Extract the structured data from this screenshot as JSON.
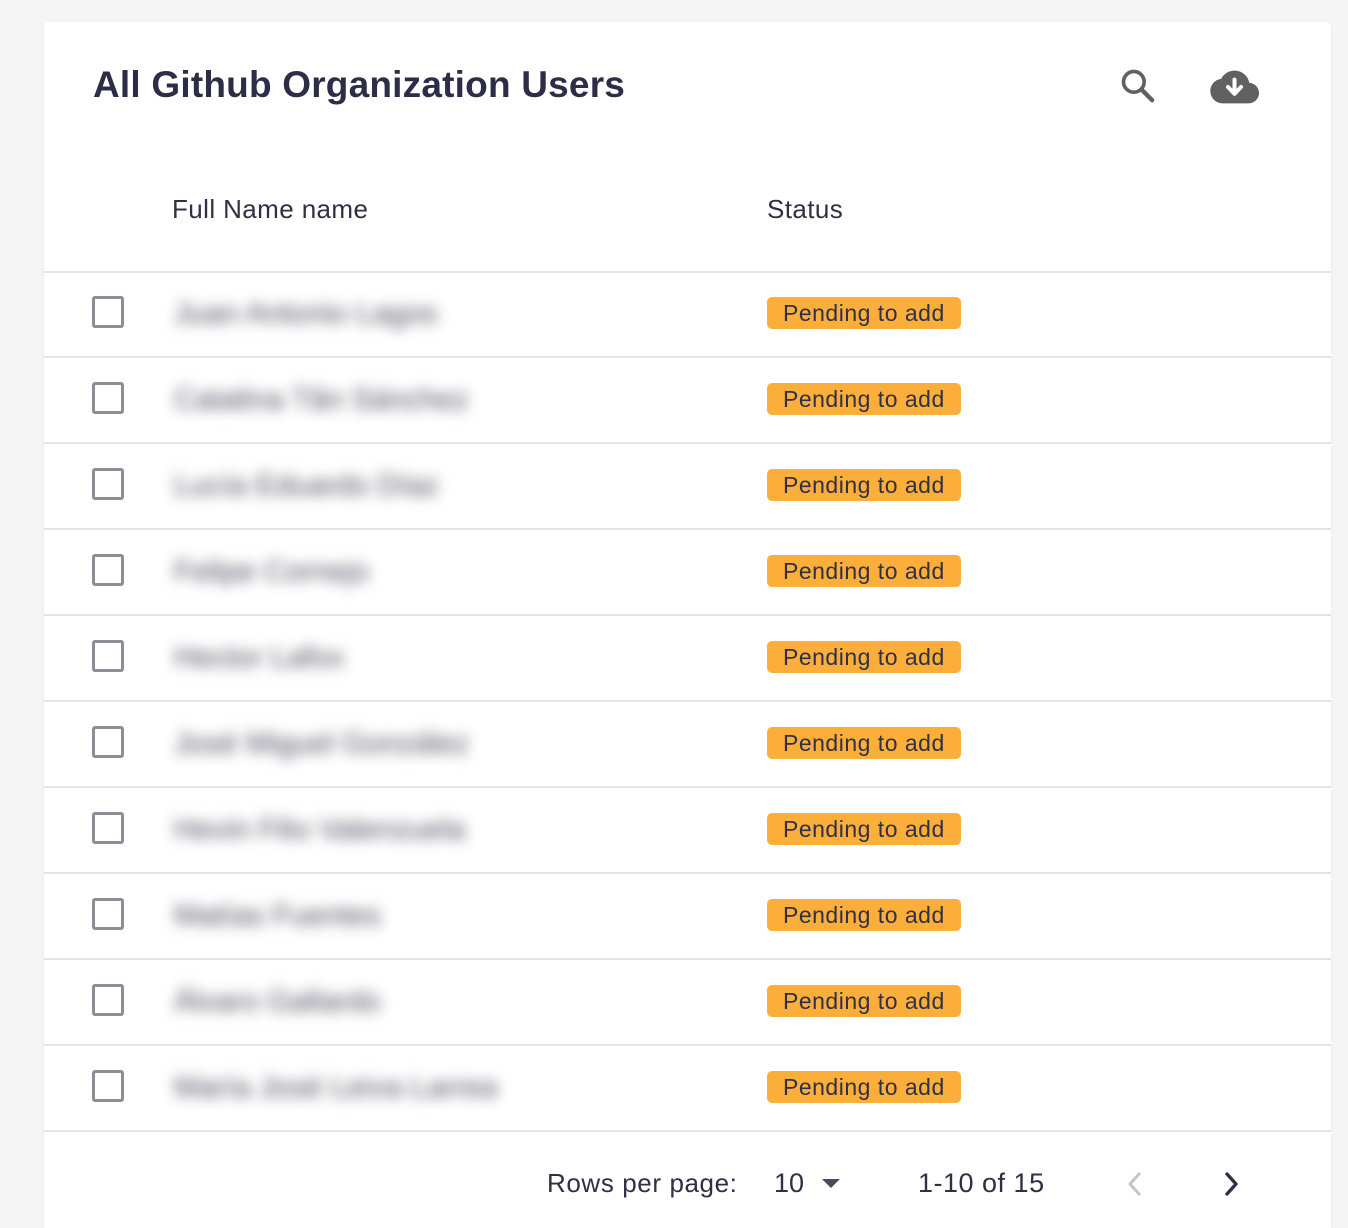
{
  "page": {
    "title": "All Github Organization Users"
  },
  "toolbar": {
    "search_icon": "search-icon",
    "download_icon": "cloud-download-icon"
  },
  "table": {
    "columns": [
      {
        "label": "Full Name name"
      },
      {
        "label": "Status"
      }
    ],
    "rows": [
      {
        "name": "Juan Antonio Lagos",
        "status": "Pending to add"
      },
      {
        "name": "Catalina Tân Sánchez",
        "status": "Pending to add"
      },
      {
        "name": "Lucía Eduardo Díaz",
        "status": "Pending to add"
      },
      {
        "name": "Felipe Cornejo",
        "status": "Pending to add"
      },
      {
        "name": "Hector Lafox",
        "status": "Pending to add"
      },
      {
        "name": "José Miguel González",
        "status": "Pending to add"
      },
      {
        "name": "Hevin Fêo Valenzuela",
        "status": "Pending to add"
      },
      {
        "name": "Matías Fuentes",
        "status": "Pending to add"
      },
      {
        "name": "Álvaro Gallardo",
        "status": "Pending to add"
      },
      {
        "name": "María José Leiva Larrea",
        "status": "Pending to add"
      }
    ]
  },
  "pagination": {
    "rows_per_page_label": "Rows per page:",
    "rows_per_page_value": "10",
    "range_text": "1-10 of 15",
    "prev_icon": "chevron-left-icon",
    "next_icon": "chevron-right-icon"
  },
  "colors": {
    "status_badge": "#fbaf3a",
    "text_primary": "#2f2f45",
    "divider": "#e4e4e8",
    "checkbox_border": "#8d8d98"
  }
}
